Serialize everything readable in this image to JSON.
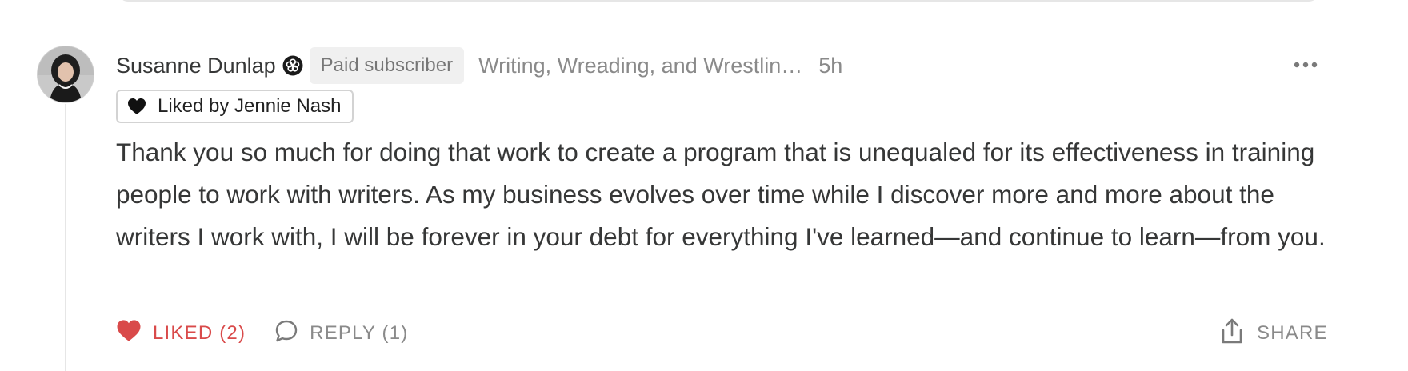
{
  "comment": {
    "author": {
      "name": "Susanne Dunlap",
      "avatar": "avatar",
      "verified_icon": "flower-badge-icon"
    },
    "badge": "Paid subscriber",
    "publication": "Writing, Wreading, and Wrestlin…",
    "timestamp": "5h",
    "more_icon": "ellipsis-icon",
    "liked_by": {
      "icon": "heart-icon",
      "text": "Liked by Jennie Nash"
    },
    "body": "Thank you so much for doing that work to create a program that is unequaled for its effectiveness in training people to work with writers. As my business evolves over time while I discover more and more about the writers I work with, I will be forever in your debt for everything I've learned—and continue to learn—from you.",
    "actions": {
      "like_label": "LIKED (2)",
      "like_icon": "heart-filled-icon",
      "reply_label": "REPLY (1)",
      "reply_icon": "speech-bubble-icon",
      "share_label": "SHARE",
      "share_icon": "share-upload-icon"
    }
  },
  "colors": {
    "liked_red": "#d94a4a",
    "muted_gray": "#8a8a8a",
    "text": "#363737",
    "badge_bg": "#f0f0f0"
  }
}
